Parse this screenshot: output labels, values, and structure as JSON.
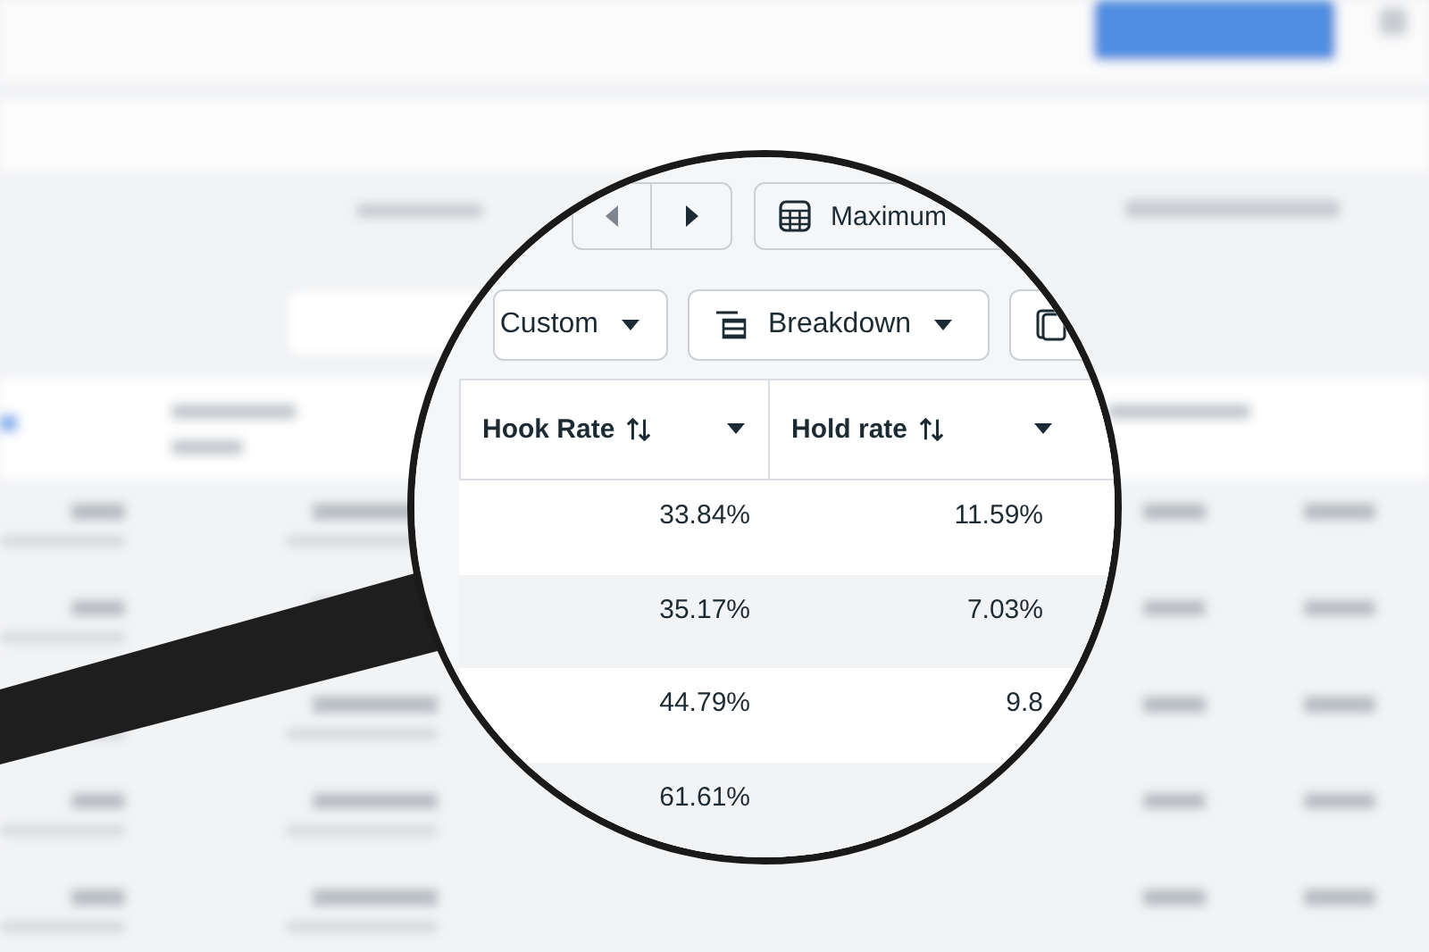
{
  "pager": [
    {
      "kind": "previous",
      "disabled": true
    },
    {
      "kind": "next",
      "disabled": false
    }
  ],
  "date_button": {
    "label": "Maximum"
  },
  "toolbar": [
    {
      "kind": "dropdown",
      "label": "Custom"
    },
    {
      "kind": "breakdown",
      "label": "Breakdown"
    },
    {
      "kind": "icon"
    }
  ],
  "table": {
    "columns": [
      {
        "label": "Hook Rate"
      },
      {
        "label": "Hold rate"
      }
    ],
    "rows": [
      {
        "hook_rate": "33.84%",
        "hold_rate": "11.59%"
      },
      {
        "hook_rate": "35.17%",
        "hold_rate": "7.03%"
      },
      {
        "hook_rate": "44.79%",
        "hold_rate": "9.8"
      },
      {
        "hook_rate": "61.61%"
      }
    ]
  }
}
